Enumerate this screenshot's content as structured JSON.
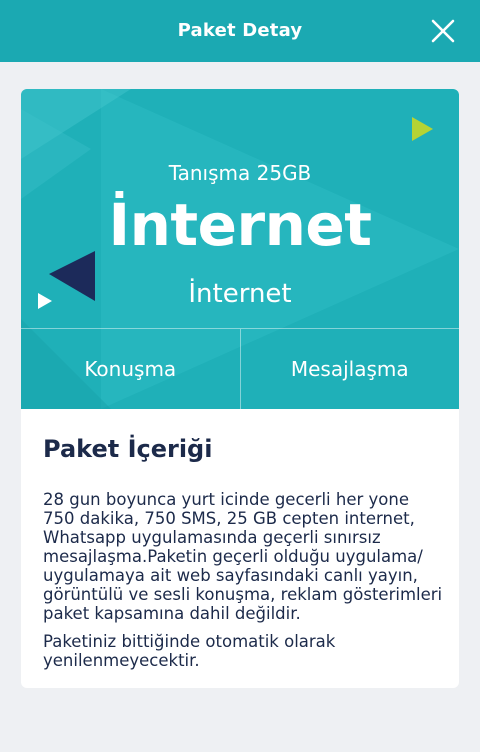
{
  "header": {
    "title": "Paket Detay",
    "close_icon": "close-icon"
  },
  "package": {
    "name": "Tanışma 25GB",
    "headline": "İnternet",
    "subtitle": "İnternet",
    "tabs": [
      {
        "label": "Konuşma"
      },
      {
        "label": "Mesajlaşma"
      }
    ]
  },
  "details": {
    "title": "Paket İçeriği",
    "paragraphs": [
      "28 gun boyunca yurt icinde gecerli her yone 750 dakika, 750 SMS, 25 GB cepten internet, Whatsapp uygulamasında geçerli sınırsız mesajlaşma.Paketin geçerli olduğu uygulama/ uygulamaya ait web sayfasındaki canlı yayın, görüntülü ve sesli konuşma, reklam gösterimleri paket kapsamına dahil değildir.",
      "Paketiniz bittiğinde otomatik olarak yenilenmeyecektir."
    ]
  },
  "colors": {
    "topbar": "#1ba9b2",
    "hero": "#1fb0b8",
    "accent_green": "#b5d334",
    "navy": "#1c2a5a",
    "text_dark": "#1c2a4a"
  }
}
